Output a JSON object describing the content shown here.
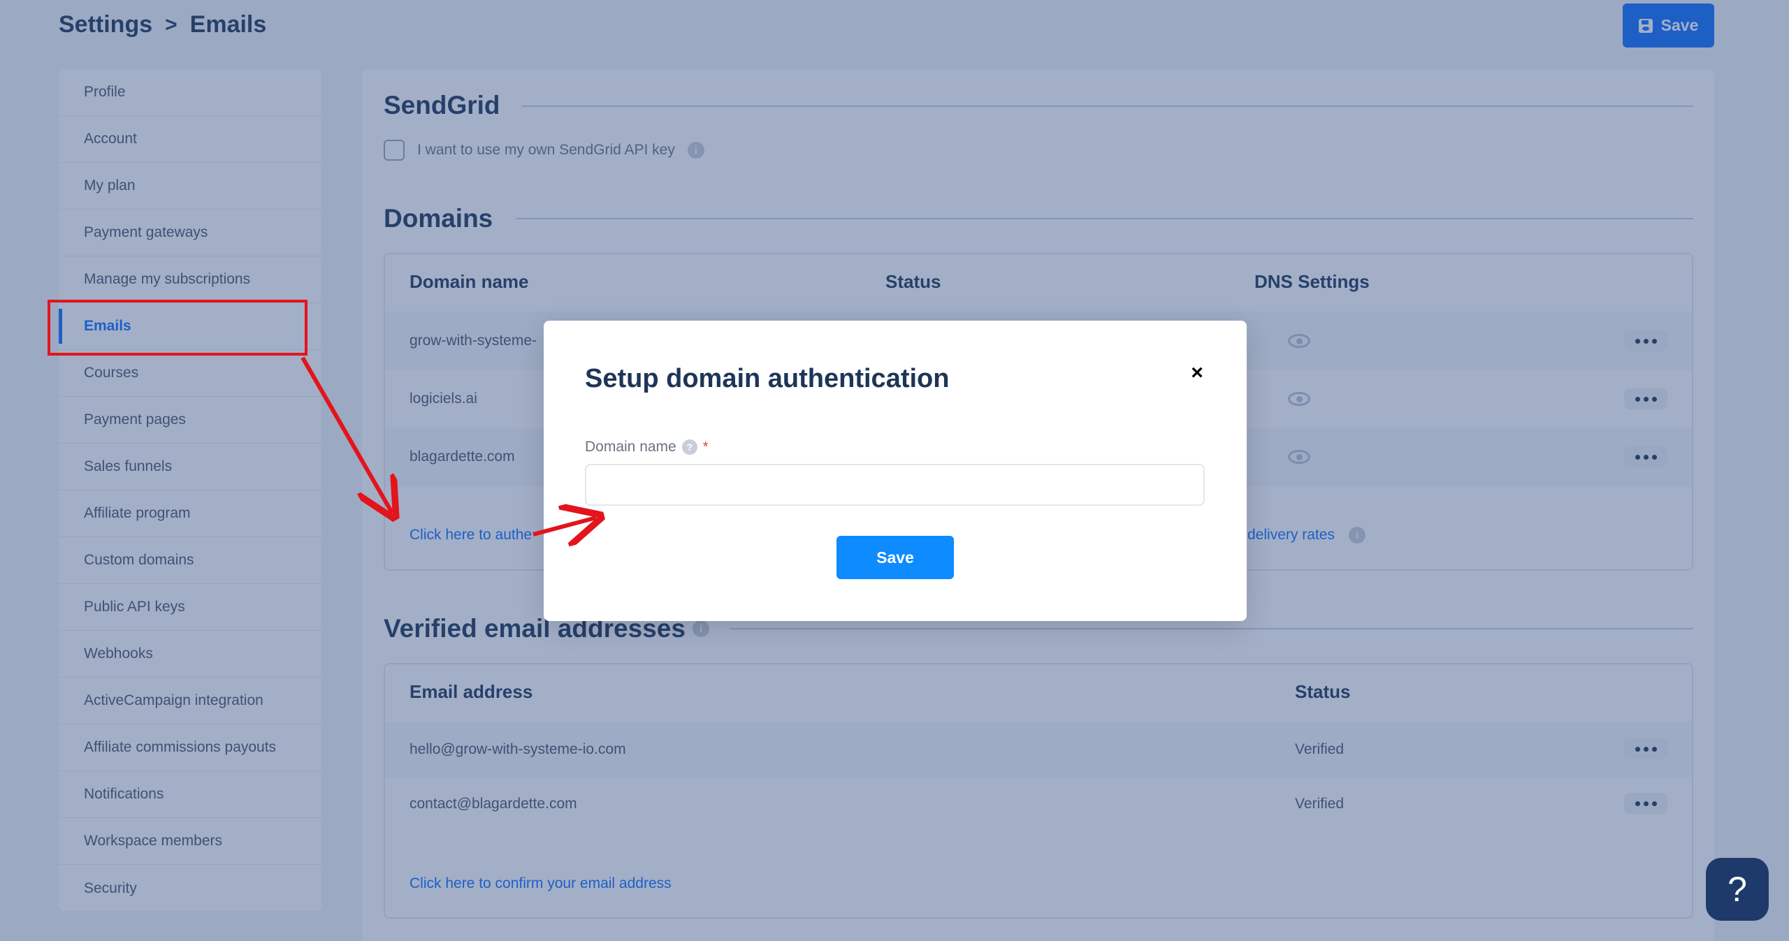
{
  "header": {
    "breadcrumb_root": "Settings",
    "breadcrumb_sep": ">",
    "breadcrumb_current": "Emails",
    "save_label": "Save"
  },
  "sidebar": {
    "items": [
      {
        "label": "Profile"
      },
      {
        "label": "Account"
      },
      {
        "label": "My plan"
      },
      {
        "label": "Payment gateways"
      },
      {
        "label": "Manage my subscriptions"
      },
      {
        "label": "Emails"
      },
      {
        "label": "Courses"
      },
      {
        "label": "Payment pages"
      },
      {
        "label": "Sales funnels"
      },
      {
        "label": "Affiliate program"
      },
      {
        "label": "Custom domains"
      },
      {
        "label": "Public API keys"
      },
      {
        "label": "Webhooks"
      },
      {
        "label": "ActiveCampaign integration"
      },
      {
        "label": "Affiliate commissions payouts"
      },
      {
        "label": "Notifications"
      },
      {
        "label": "Workspace members"
      },
      {
        "label": "Security"
      }
    ],
    "active": "Emails"
  },
  "sendgrid": {
    "title": "SendGrid",
    "checkbox_label": "I want to use my own SendGrid API key",
    "checked": false
  },
  "domains": {
    "title": "Domains",
    "headers": {
      "name": "Domain name",
      "status": "Status",
      "dns": "DNS Settings"
    },
    "rows": [
      {
        "name": "grow-with-systeme-"
      },
      {
        "name": "logiciels.ai"
      },
      {
        "name": "blagardette.com"
      }
    ],
    "link_left": "Click here to authe",
    "link_right": "delivery rates"
  },
  "verified": {
    "title": "Verified email addresses",
    "headers": {
      "email": "Email address",
      "status": "Status"
    },
    "rows": [
      {
        "email": "hello@grow-with-systeme-io.com",
        "status": "Verified"
      },
      {
        "email": "contact@blagardette.com",
        "status": "Verified"
      }
    ],
    "link": "Click here to confirm your email address"
  },
  "modal": {
    "title": "Setup domain authentication",
    "field_label": "Domain name",
    "required_mark": "*",
    "input_value": "",
    "save_label": "Save",
    "close_glyph": "×"
  },
  "help": {
    "glyph": "?"
  },
  "colors": {
    "accent": "#0d6efd",
    "overlay": "#344e82",
    "annotation": "#e3141c",
    "heading": "#1d3557"
  }
}
